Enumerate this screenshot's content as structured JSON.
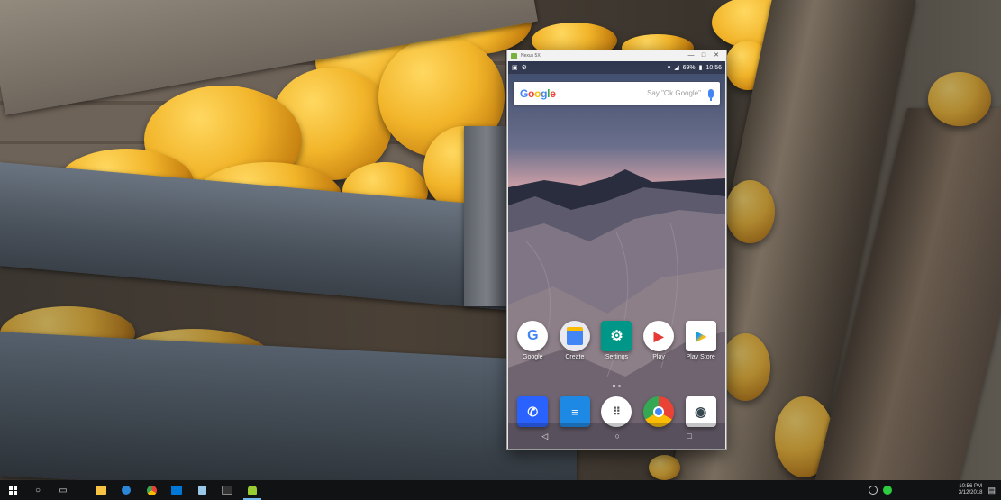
{
  "emulator_window": {
    "title": "Nexus 5X",
    "controls": [
      "—",
      "□",
      "✕"
    ]
  },
  "statusbar": {
    "battery": "69%",
    "time": "10:56"
  },
  "search": {
    "logo": "Google",
    "hint": "Say \"Ok Google\""
  },
  "home_apps": [
    {
      "label": "Google",
      "icon": "google-app-icon"
    },
    {
      "label": "Create",
      "icon": "docs-create-icon"
    },
    {
      "label": "Settings",
      "icon": "settings-gear-icon"
    },
    {
      "label": "Play",
      "icon": "play-movies-icon"
    },
    {
      "label": "Play Store",
      "icon": "play-store-icon"
    }
  ],
  "dock_apps": [
    {
      "icon": "phone-icon"
    },
    {
      "icon": "messages-icon"
    },
    {
      "icon": "app-drawer-icon"
    },
    {
      "icon": "chrome-icon"
    },
    {
      "icon": "camera-icon"
    }
  ],
  "colors": {
    "google_blue": "#4285f4",
    "google_red": "#ea4335",
    "google_yellow": "#fbbc05",
    "google_green": "#34a853",
    "taskbar": "#101214"
  },
  "taskbar": {
    "clock_time": "10:56 PM",
    "clock_date": "3/12/2018"
  }
}
